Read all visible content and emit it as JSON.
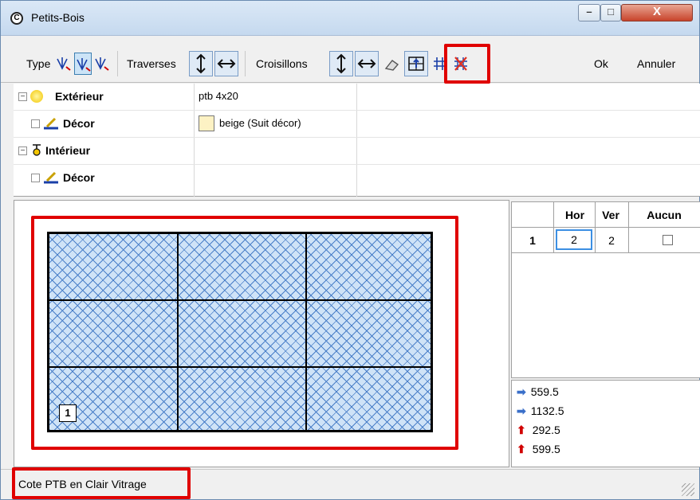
{
  "window": {
    "title": "Petits-Bois",
    "min_symbol": "–",
    "max_symbol": "□",
    "close_symbol": "X"
  },
  "toolbar": {
    "type_label": "Type",
    "traverses_label": "Traverses",
    "croisillons_label": "Croisillons",
    "ok_label": "Ok",
    "cancel_label": "Annuler"
  },
  "properties": {
    "exterieur": {
      "label": "Extérieur",
      "value": "ptb 4x20"
    },
    "decor_ext": {
      "label": "Décor",
      "value": "beige (Suit décor)",
      "swatch": "#fdf2c4"
    },
    "interieur": {
      "label": "Intérieur",
      "value": ""
    },
    "decor_int": {
      "label": "Décor",
      "value": ""
    }
  },
  "canvas": {
    "pane_number": "1",
    "hatch_color": "#4a7fc8",
    "fill_color": "#cfe3f7"
  },
  "table": {
    "headers": [
      "Hor",
      "Ver",
      "Aucun"
    ],
    "rows": [
      {
        "index": "1",
        "hor": "2",
        "ver": "2",
        "aucun": false
      }
    ]
  },
  "dimensions": [
    {
      "arrow": "right",
      "value": "559.5"
    },
    {
      "arrow": "right",
      "value": "1132.5"
    },
    {
      "arrow": "up",
      "value": "292.5"
    },
    {
      "arrow": "up",
      "value": "599.5"
    }
  ],
  "status": {
    "text": "Cote PTB en Clair Vitrage"
  },
  "colors": {
    "highlight": "#e00000",
    "selected": "#3c8fe3"
  }
}
